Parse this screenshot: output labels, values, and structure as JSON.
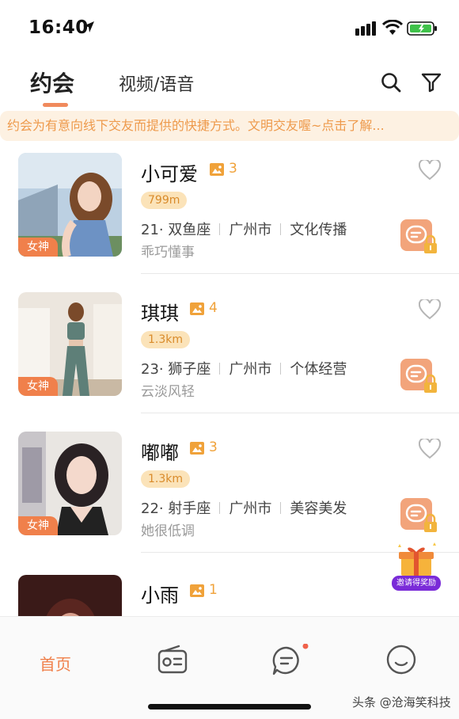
{
  "status_bar": {
    "time": "16:40"
  },
  "header": {
    "tabs": [
      {
        "label": "约会",
        "active": true
      },
      {
        "label": "视频/语音",
        "active": false
      }
    ]
  },
  "notice": {
    "text": "约会为有意向线下交友而提供的快捷方式。文明交友喔~点击了解..."
  },
  "profiles": [
    {
      "name": "小可爱",
      "photos": "3",
      "distance": "799m",
      "age_sign": "21· 双鱼座",
      "city": "广州市",
      "industry": "文化传播",
      "desc": "乖巧懂事",
      "badge": "女神"
    },
    {
      "name": "琪琪",
      "photos": "4",
      "distance": "1.3km",
      "age_sign": "23· 狮子座",
      "city": "广州市",
      "industry": "个体经营",
      "desc": "云淡风轻",
      "badge": "女神"
    },
    {
      "name": "嘟嘟",
      "photos": "3",
      "distance": "1.3km",
      "age_sign": "22· 射手座",
      "city": "广州市",
      "industry": "美容美发",
      "desc": "她很低调",
      "badge": "女神"
    },
    {
      "name": "小雨",
      "photos": "1",
      "distance": "",
      "age_sign": "",
      "city": "",
      "industry": "",
      "desc": "",
      "badge": ""
    }
  ],
  "gift": {
    "label": "邀请得奖励"
  },
  "bottom_nav": {
    "home_label": "首页"
  },
  "watermark": "头条 @沧海笑科技",
  "colors": {
    "accent": "#f0804b",
    "notice_bg": "#fdf1e2",
    "notice_text": "#ee9a4c",
    "distance_bg": "#fbe3b9",
    "photo_count": "#f0a23a"
  }
}
